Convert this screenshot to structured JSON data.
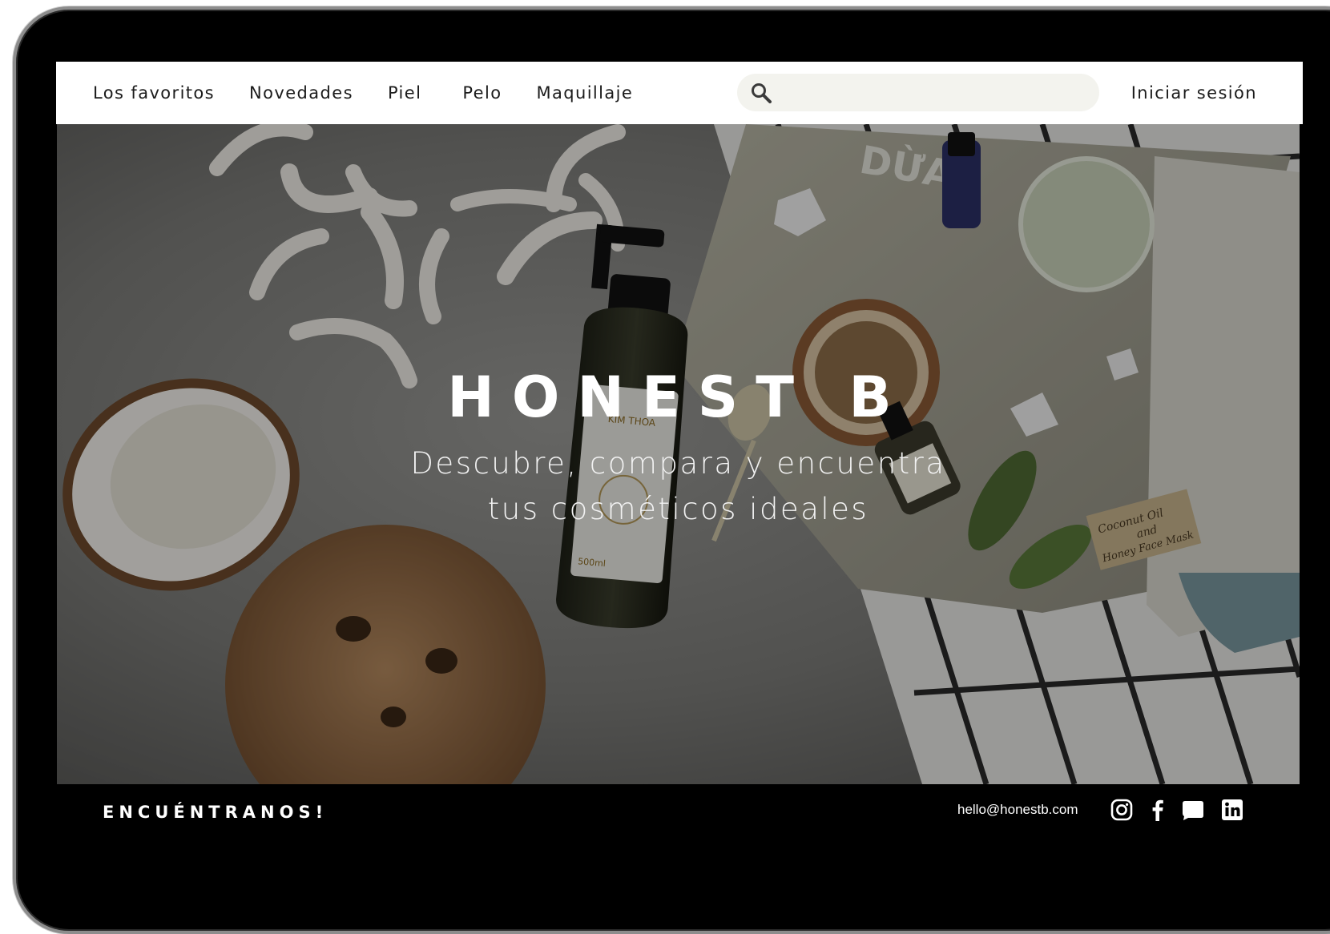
{
  "nav": {
    "items": [
      {
        "label": "Los favoritos"
      },
      {
        "label": "Novedades"
      },
      {
        "label": "Piel"
      },
      {
        "label": "Pelo"
      },
      {
        "label": "Maquillaje"
      }
    ],
    "search": {
      "placeholder": "",
      "value": ""
    },
    "login_label": "Iniciar sesión"
  },
  "hero": {
    "title": "HONEST B",
    "subtitle_line1": "Descubre, compara y encuentra",
    "subtitle_line2": "tus cosméticos ideales",
    "bottle_label": {
      "brand": "KIM THOA",
      "volume": "500ml"
    },
    "magazine_title": "DỪA",
    "tag_text": {
      "line1": "Coconut Oil",
      "line2": "and",
      "line3": "Honey Face Mask"
    }
  },
  "footer": {
    "cta": "ENCUÉNTRANOS!",
    "email": "hello@honestb.com",
    "social": [
      "instagram-icon",
      "facebook-icon",
      "message-icon",
      "linkedin-icon"
    ]
  },
  "colors": {
    "nav_bg": "#ffffff",
    "search_bg": "#f3f3ee",
    "frame": "#000000",
    "text_light": "#ffffff"
  }
}
